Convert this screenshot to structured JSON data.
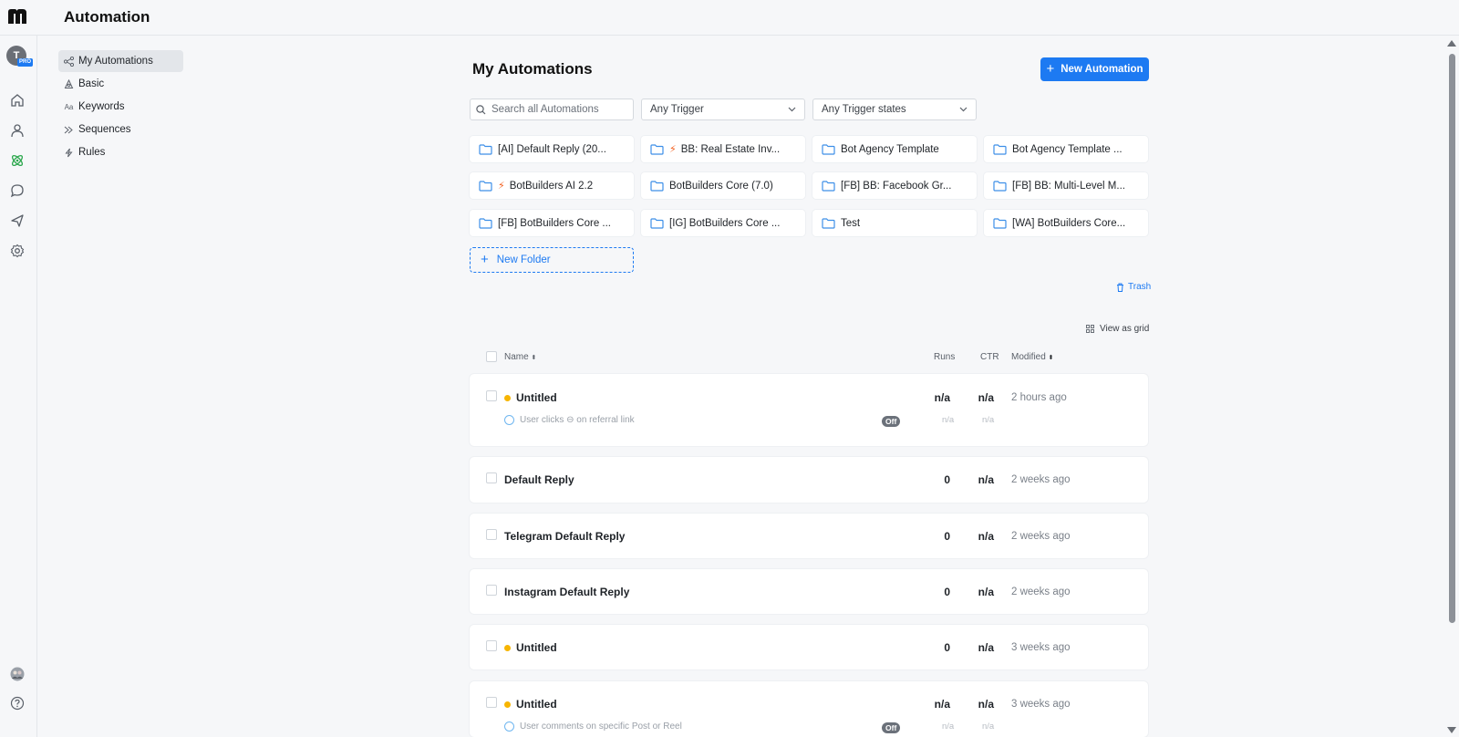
{
  "header": {
    "title": "Automation"
  },
  "rail": {
    "avatar_initial": "T",
    "pro_badge": "PRO",
    "icons": [
      "home-icon",
      "contacts-icon",
      "automation-icon",
      "live-chat-icon",
      "broadcast-icon",
      "settings-icon",
      "workspace-avatar",
      "help-icon"
    ],
    "active_color": "#2ea84f"
  },
  "subnav": {
    "items": [
      {
        "label": "My Automations",
        "icon": "flow-icon",
        "active": true
      },
      {
        "label": "Basic",
        "icon": "basic-icon"
      },
      {
        "label": "Keywords",
        "icon": "keywords-icon"
      },
      {
        "label": "Sequences",
        "icon": "sequences-icon"
      },
      {
        "label": "Rules",
        "icon": "rules-icon"
      }
    ]
  },
  "main": {
    "title": "My Automations",
    "new_button": "New Automation",
    "search_placeholder": "Search all Automations",
    "filter_trigger": "Any Trigger",
    "filter_states": "Any Trigger states",
    "folders": [
      {
        "label": "[AI] Default Reply (20...",
        "bolt": false
      },
      {
        "label": "BB: Real Estate Inv...",
        "bolt": true
      },
      {
        "label": "Bot Agency Template",
        "bolt": false
      },
      {
        "label": "Bot Agency Template ...",
        "bolt": false
      },
      {
        "label": "BotBuilders AI 2.2",
        "bolt": true
      },
      {
        "label": "BotBuilders Core (7.0)",
        "bolt": false
      },
      {
        "label": "[FB] BB: Facebook Gr...",
        "bolt": false
      },
      {
        "label": "[FB] BB: Multi-Level M...",
        "bolt": false
      },
      {
        "label": "[FB] BotBuilders Core ...",
        "bolt": false
      },
      {
        "label": "[IG] BotBuilders Core ...",
        "bolt": false
      },
      {
        "label": "Test",
        "bolt": false
      },
      {
        "label": "[WA] BotBuilders Core...",
        "bolt": false
      }
    ],
    "new_folder": "New Folder",
    "trash": "Trash",
    "view_as_grid": "View as grid",
    "accent": "#1d7af2"
  },
  "table": {
    "columns": {
      "name": "Name",
      "runs": "Runs",
      "ctr": "CTR",
      "modified": "Modified"
    },
    "rows": [
      {
        "name": "Untitled",
        "draft": true,
        "runs": "n/a",
        "ctr": "n/a",
        "modified": "2 hours ago",
        "trigger": "User clicks ⊖ on referral link",
        "status": "Off",
        "sub_runs": "n/a",
        "sub_ctr": "n/a"
      },
      {
        "name": "Default Reply",
        "draft": false,
        "runs": "0",
        "ctr": "n/a",
        "modified": "2 weeks ago"
      },
      {
        "name": "Telegram Default Reply",
        "draft": false,
        "runs": "0",
        "ctr": "n/a",
        "modified": "2 weeks ago"
      },
      {
        "name": "Instagram Default Reply",
        "draft": false,
        "runs": "0",
        "ctr": "n/a",
        "modified": "2 weeks ago"
      },
      {
        "name": "Untitled",
        "draft": true,
        "runs": "0",
        "ctr": "n/a",
        "modified": "3 weeks ago"
      },
      {
        "name": "Untitled",
        "draft": true,
        "runs": "n/a",
        "ctr": "n/a",
        "modified": "3 weeks ago",
        "trigger": "User comments on specific Post or Reel",
        "status": "Off",
        "sub_runs": "n/a",
        "sub_ctr": "n/a"
      }
    ]
  }
}
